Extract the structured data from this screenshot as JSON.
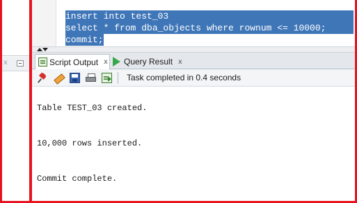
{
  "editor": {
    "lines": [
      "insert into test_03",
      "select * from dba_objects where rownum <= 10000;",
      "commit;"
    ]
  },
  "tabs": [
    {
      "label": "Script Output",
      "close": "x",
      "icon": "script-output-icon",
      "active": true
    },
    {
      "label": "Query Result",
      "close": "x",
      "icon": "run-query-icon",
      "active": false
    }
  ],
  "toolbar": {
    "icons": [
      "pin-icon",
      "eraser-icon",
      "save-icon",
      "print-icon",
      "export-icon"
    ],
    "status": "Task completed in 0.4 seconds"
  },
  "output": {
    "lines": [
      "Table TEST_03 created.",
      "10,000 rows inserted.",
      "Commit complete."
    ]
  },
  "left_panel": {
    "close": "x"
  },
  "colors": {
    "selection": "#3f76b8",
    "border_red": "#e8121f"
  }
}
